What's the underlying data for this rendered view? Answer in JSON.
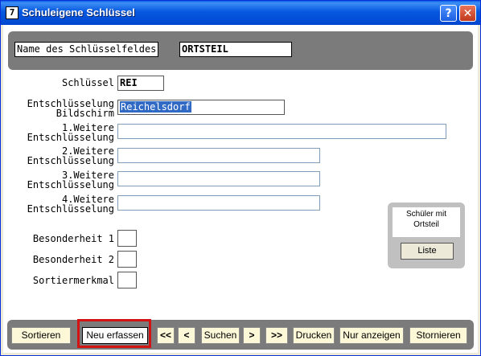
{
  "window": {
    "title": "Schuleigene Schlüssel",
    "app_icon": "7",
    "help_glyph": "?",
    "close_glyph": "✕"
  },
  "header": {
    "field_label": "Name des Schlüsselfeldes",
    "field_value": "ORTSTEIL"
  },
  "form": {
    "schluessel_label": "Schlüssel",
    "schluessel_value": "REI",
    "entschl_bildschirm_label_1": "Entschlüsselung",
    "entschl_bildschirm_label_2": "Bildschirm",
    "entschl_bildschirm_value": "Reichelsdorf",
    "weitere": [
      {
        "label_1": "1.Weitere",
        "label_2": "Entschlüsselung",
        "value": ""
      },
      {
        "label_1": "2.Weitere",
        "label_2": "Entschlüsselung",
        "value": ""
      },
      {
        "label_1": "3.Weitere",
        "label_2": "Entschlüsselung",
        "value": ""
      },
      {
        "label_1": "4.Weitere",
        "label_2": "Entschlüsselung",
        "value": ""
      }
    ],
    "besonderheit_1_label": "Besonderheit 1",
    "besonderheit_2_label": "Besonderheit 2",
    "sortiermerkmal_label": "Sortiermerkmal"
  },
  "side_panel": {
    "text_line_1": "Schüler mit",
    "text_line_2": "Ortsteil",
    "button": "Liste"
  },
  "toolbar": {
    "sortieren": "Sortieren",
    "neu_erfassen": "Neu erfassen",
    "first": "<<",
    "prev": "<",
    "suchen": "Suchen",
    "next": ">",
    "last": ">>",
    "drucken": "Drucken",
    "nur_anzeigen": "Nur anzeigen",
    "stornieren": "Stornieren"
  },
  "colors": {
    "highlight": "#d21414",
    "selection": "#316ac5",
    "titlebar": "#0758e0"
  }
}
